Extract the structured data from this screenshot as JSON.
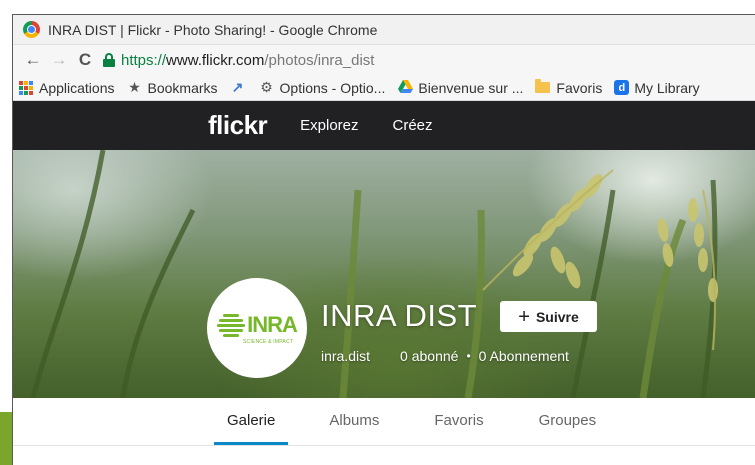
{
  "browser": {
    "title": "INRA DIST | Flickr - Photo Sharing! - Google Chrome",
    "url_scheme": "https://",
    "url_host": "www.flickr.com",
    "url_path": "/photos/inra_dist",
    "bookmarks": [
      {
        "label": "Applications",
        "icon": "apps-icon"
      },
      {
        "label": "Bookmarks",
        "icon": "star-icon"
      },
      {
        "label": "",
        "icon": "bookmark-pin-icon"
      },
      {
        "label": "Options - Optio...",
        "icon": "gear-icon"
      },
      {
        "label": "Bienvenue sur ...",
        "icon": "drive-icon"
      },
      {
        "label": "Favoris",
        "icon": "folder-icon"
      },
      {
        "label": "My Library",
        "icon": "d-app-icon"
      }
    ]
  },
  "flickr": {
    "logo": "flickr",
    "nav": [
      "Explorez",
      "Créez"
    ],
    "profile": {
      "name": "INRA DIST",
      "username": "inra.dist",
      "followers": "0 abonné",
      "following": "0 Abonnement",
      "follow_label": "Suivre",
      "avatar_logo_text": "INRA",
      "avatar_logo_sub": "SCIENCE & IMPACT"
    },
    "tabs": [
      "Galerie",
      "Albums",
      "Favoris",
      "Groupes"
    ],
    "active_tab": "Galerie"
  },
  "colors": {
    "flickr_nav_bg": "#212124",
    "tab_active_underline": "#0a88c7",
    "https_green": "#0b8043",
    "inra_green": "#76b82a"
  }
}
